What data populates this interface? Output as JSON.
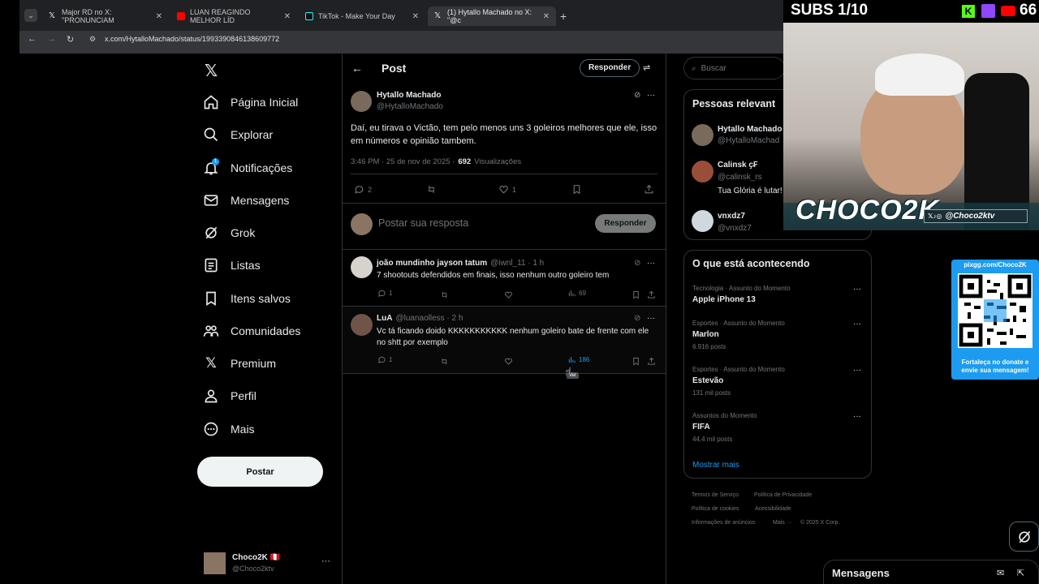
{
  "browser": {
    "tabs": [
      {
        "title": "Major RD no X: \"PRONUNCIAM",
        "color": "#ffffff"
      },
      {
        "title": "LUAN REAGINDO MELHOR LÍD",
        "color": "#ff0000"
      },
      {
        "title": "TikTok - Make Your Day",
        "color": "#25f4ee"
      },
      {
        "title": "(1) Hytallo Machado no X: \"@c",
        "color": "#ffffff"
      }
    ],
    "url": "x.com/HytalloMachado/status/1993390846138609772"
  },
  "nav": {
    "items": [
      {
        "label": "Página Inicial",
        "icon": "home-icon"
      },
      {
        "label": "Explorar",
        "icon": "search-icon"
      },
      {
        "label": "Notificações",
        "icon": "bell-icon"
      },
      {
        "label": "Mensagens",
        "icon": "mail-icon"
      },
      {
        "label": "Grok",
        "icon": "grok-icon"
      },
      {
        "label": "Listas",
        "icon": "list-icon"
      },
      {
        "label": "Itens salvos",
        "icon": "bookmark-icon"
      },
      {
        "label": "Comunidades",
        "icon": "people-icon"
      },
      {
        "label": "Premium",
        "icon": "x-logo-icon"
      },
      {
        "label": "Perfil",
        "icon": "person-icon"
      },
      {
        "label": "Mais",
        "icon": "more-circle-icon"
      }
    ],
    "notif_badge": "1",
    "post_label": "Postar",
    "account": {
      "name": "Choco2K 🇵🇪",
      "handle": "@Choco2ktv"
    }
  },
  "post": {
    "header_title": "Post",
    "reply_btn": "Responder",
    "author": "Hytallo Machado",
    "handle": "@HytalloMachado",
    "text": "Daí, eu tirava o Victão, tem pelo menos uns 3 goleiros melhores que ele, isso em números e opinião tambem.",
    "time": "3:46 PM · 25 de nov de 2025 ·",
    "views_count": "692",
    "views_label": "Visualizações",
    "replies": "2",
    "likes": "1",
    "composer_placeholder": "Postar sua resposta",
    "composer_btn": "Responder"
  },
  "replies": [
    {
      "name": "joão mundinho jayson tatum",
      "handle": "@iwnl_11 · 1 h",
      "text": "7 shootouts defendidos em finais, isso nenhum outro goleiro tem",
      "replies": "1",
      "views": "69"
    },
    {
      "name": "LuA",
      "handle": "@luanaolless · 2 h",
      "text": "Vc tá ficando doido KKKKKKKKKKK nenhum goleiro bate de frente com ele no shtt por exemplo",
      "replies": "1",
      "views": "186"
    }
  ],
  "right": {
    "search_placeholder": "Buscar",
    "relevant_title": "Pessoas relevant",
    "people": [
      {
        "name": "Hytallo Machado",
        "handle": "@HytalloMachad",
        "bio": ""
      },
      {
        "name": "Calinsk ҫ₣",
        "handle": "@calinsk_rs",
        "bio": "Tua Glória é lutar!"
      },
      {
        "name": "vnxdz7",
        "handle": "@vnxdz7",
        "bio": ""
      }
    ],
    "trends_title": "O que está acontecendo",
    "trends": [
      {
        "cat": "Tecnologia · Assunto do Momento",
        "name": "Apple iPhone 13",
        "count": ""
      },
      {
        "cat": "Esportes · Assunto do Momento",
        "name": "Marlon",
        "count": "6.916 posts"
      },
      {
        "cat": "Esportes · Assunto do Momento",
        "name": "Estevão",
        "count": "131 mil posts"
      },
      {
        "cat": "Assuntos do Momento",
        "name": "FIFA",
        "count": "44,4 mil posts"
      }
    ],
    "show_more": "Mostrar mais",
    "footer": [
      "Termos de Serviço",
      "Política de Privacidade",
      "Política de cookies",
      "Acessibilidade",
      "Informações de anúncios",
      "Mais ···",
      "© 2025 X Corp."
    ],
    "messages": "Mensagens"
  },
  "overlay": {
    "subs": "SUBS 1/10",
    "count": "66",
    "brand": "CHOCO2K",
    "social": "@Choco2ktv",
    "pix_top": "pixgg.com/Choco2K",
    "pix_bottom": "Fortaleça no donate e envie sua mensagem!",
    "tooltip": "Ver"
  }
}
